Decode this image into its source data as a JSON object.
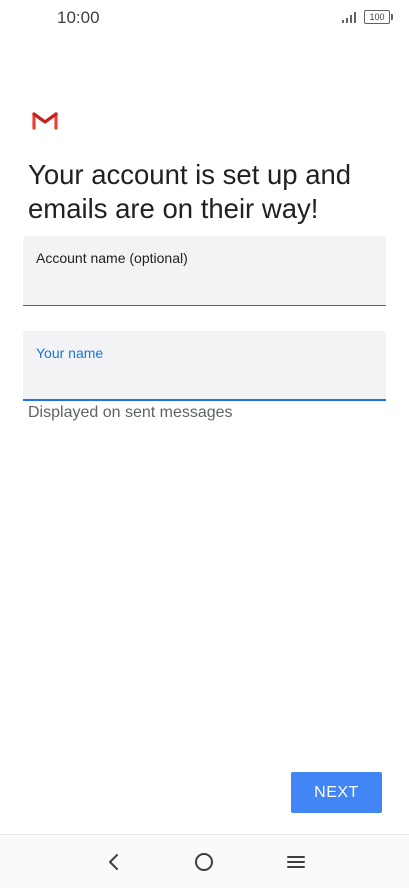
{
  "status_bar": {
    "time": "10:00",
    "battery": "100",
    "signal_icon": "signal-bars-icon",
    "battery_icon": "battery-icon"
  },
  "logo": {
    "icon": "gmail-logo-icon",
    "colors": [
      "#EA4335",
      "#C5221F"
    ]
  },
  "headline": "Your account is set up and emails are on their way!",
  "account_field": {
    "label": "Account name (optional)",
    "value": ""
  },
  "name_field": {
    "label": "Your name",
    "value": "",
    "helper": "Displayed on sent messages"
  },
  "next_button": {
    "label": "NEXT"
  },
  "navigation": {
    "back_icon": "chevron-left-icon",
    "home_icon": "circle-home-icon",
    "menu_icon": "hamburger-menu-icon"
  },
  "colors": {
    "accent": "#1A73E8",
    "button": "#4285F4",
    "field_bg": "#F1F3F4",
    "text": "#202124",
    "secondary_text": "#5F6368"
  }
}
